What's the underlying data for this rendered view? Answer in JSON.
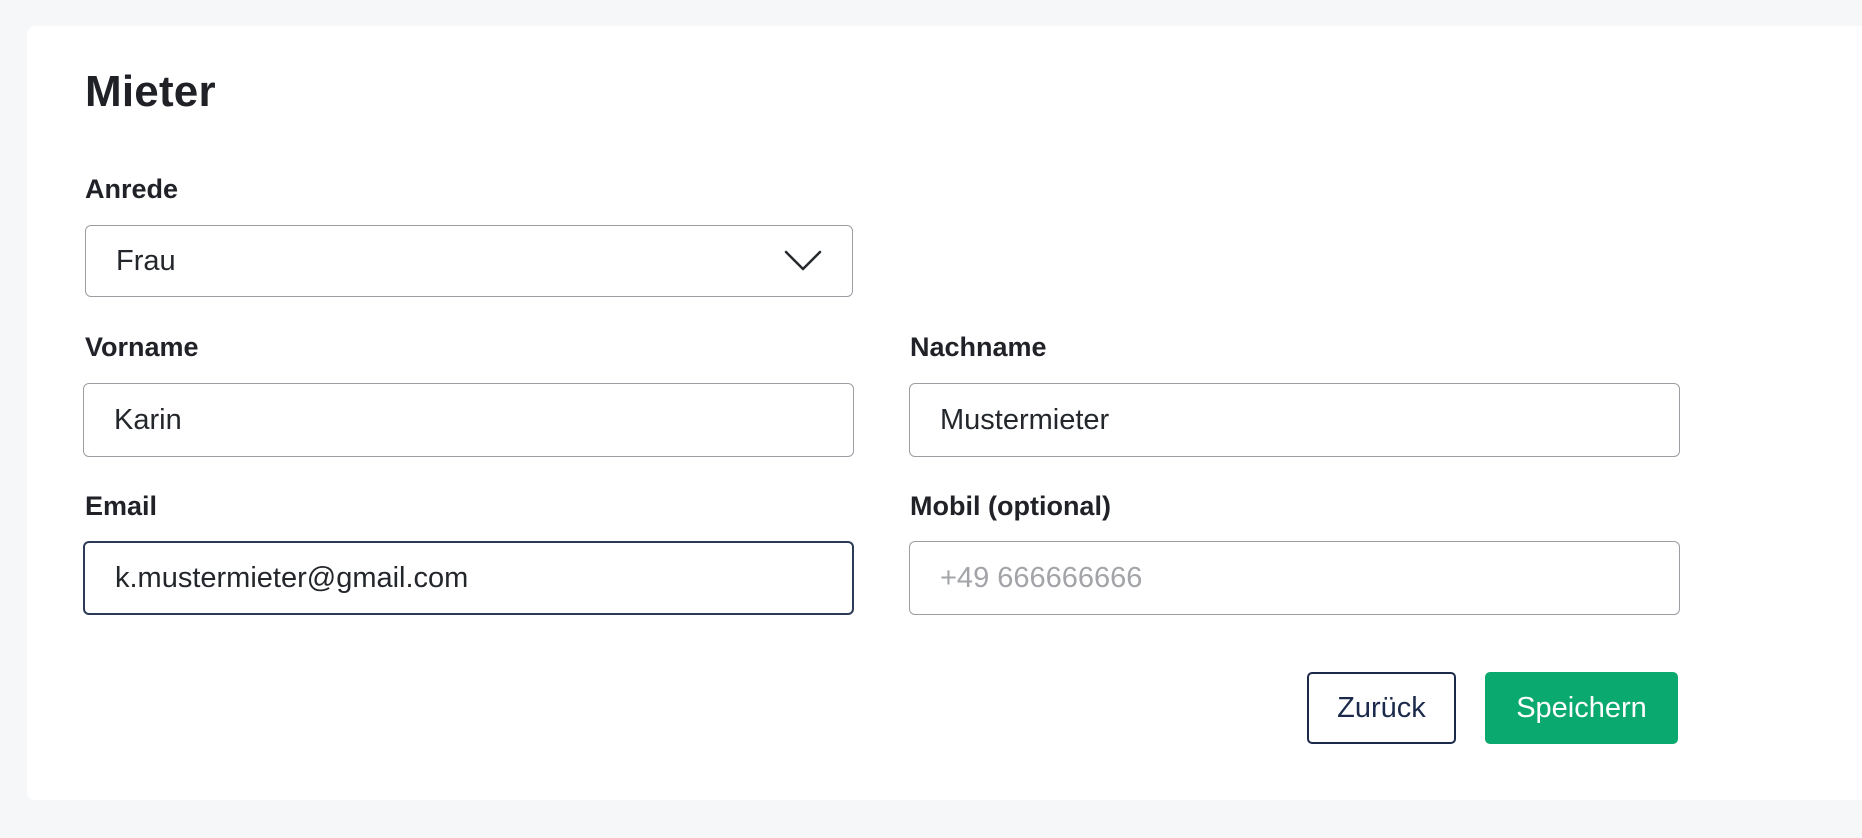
{
  "form": {
    "title": "Mieter",
    "salutation": {
      "label": "Anrede",
      "value": "Frau"
    },
    "first_name": {
      "label": "Vorname",
      "value": "Karin"
    },
    "last_name": {
      "label": "Nachname",
      "value": "Mustermieter"
    },
    "email": {
      "label": "Email",
      "value": "k.mustermieter@gmail.com"
    },
    "mobile": {
      "label": "Mobil (optional)",
      "value": "",
      "placeholder": "+49 666666666"
    }
  },
  "actions": {
    "back_label": "Zurück",
    "save_label": "Speichern"
  },
  "colors": {
    "primary": "#0aa96f",
    "navy": "#1b2a4a",
    "background": "#f6f7f9"
  },
  "icons": {
    "salutation_dropdown": "chevron-down-icon"
  }
}
